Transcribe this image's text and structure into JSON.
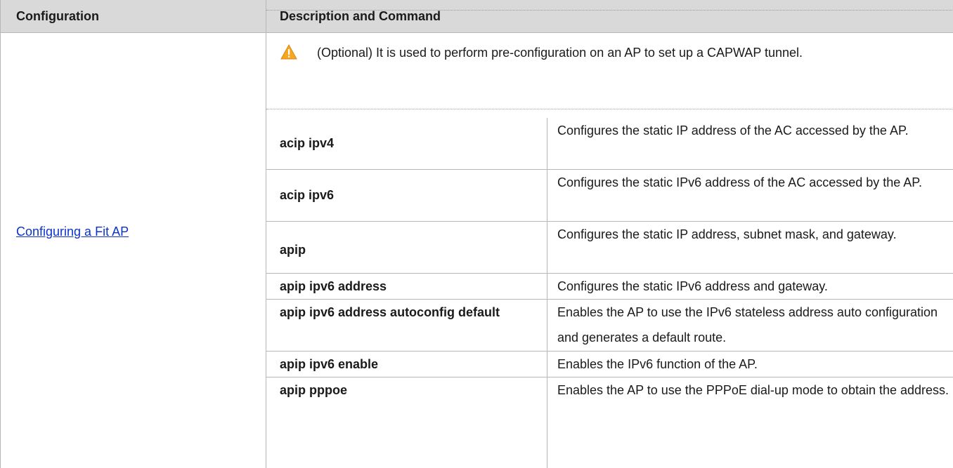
{
  "header": {
    "col_configuration": "Configuration",
    "col_description": "Description and Command"
  },
  "configuration_link": "Configuring a Fit AP",
  "note": {
    "icon": "warning-triangle-icon",
    "text": "(Optional) It is used to perform pre-configuration on an AP to set up a CAPWAP tunnel."
  },
  "commands": [
    {
      "name": "acip ipv4",
      "desc": "Configures the static IP address of the AC accessed by the AP."
    },
    {
      "name": "acip ipv6",
      "desc": "Configures the static IPv6 address of the AC accessed by the AP."
    },
    {
      "name": "apip",
      "desc": "Configures the static IP address, subnet mask, and gateway."
    },
    {
      "name": "apip ipv6 address",
      "desc": "Configures the static IPv6 address and gateway."
    },
    {
      "name": "apip ipv6 address autoconfig default",
      "desc": "Enables the AP to use the IPv6 stateless address auto configuration and generates a default route."
    },
    {
      "name": "apip ipv6 enable",
      "desc": "Enables the IPv6 function of the AP."
    },
    {
      "name": "apip pppoe",
      "desc": "Enables the AP to use the PPPoE dial-up mode to obtain the address."
    }
  ],
  "colors": {
    "header_bg": "#d9d9d9",
    "link": "#0b33c8",
    "warning": "#f5a623"
  }
}
